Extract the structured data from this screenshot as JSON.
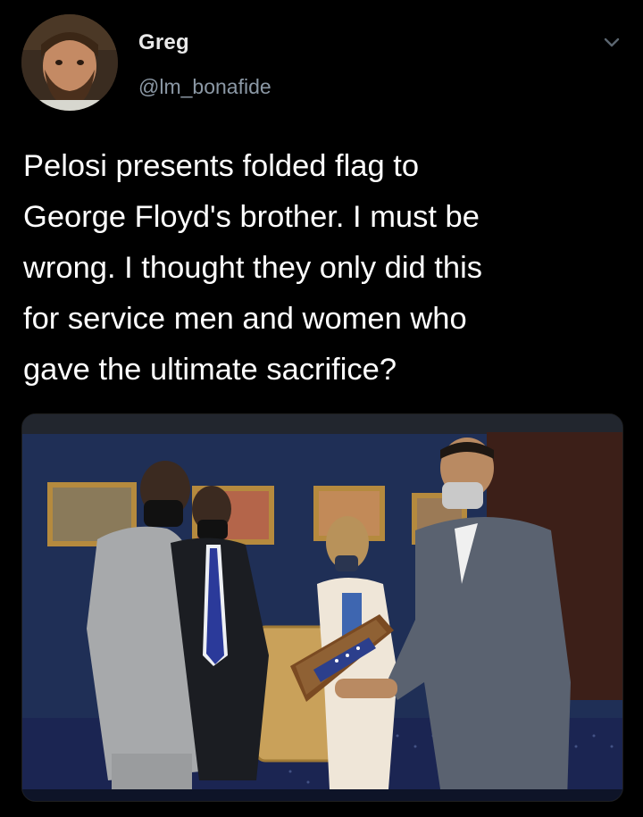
{
  "tweet": {
    "author_name": "Greg",
    "author_handle": "@lm_bonafide",
    "text_lines": [
      "Pelosi presents folded flag to",
      "George Floyd's brother. I must be",
      "wrong. I thought they only did this",
      "for service men and women who",
      "gave the ultimate sacrifice?"
    ],
    "avatar_icon": "profile-photo",
    "menu_icon": "chevron-down-icon"
  },
  "colors": {
    "background": "#000000",
    "text": "#ffffff",
    "secondary_text": "#8b98a5"
  }
}
